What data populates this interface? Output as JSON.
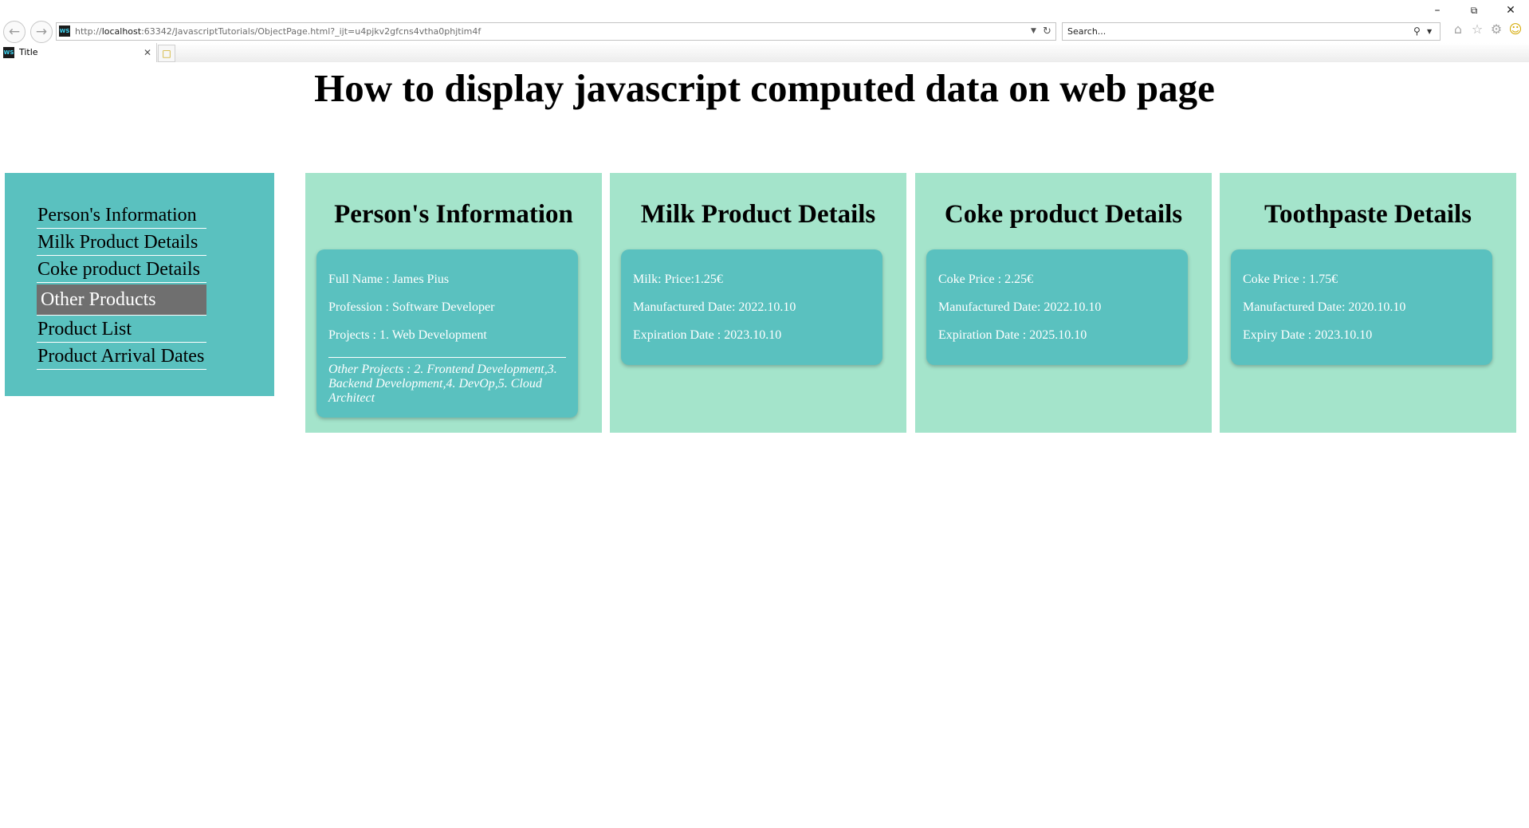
{
  "browser": {
    "url_prefix": "http://",
    "url_host": "localhost",
    "url_rest": ":63342/JavascriptTutorials/ObjectPage.html?_ijt=u4pjkv2gfcns4vtha0phjtim4f",
    "search_placeholder": "Search...",
    "tab_title": "Title",
    "favicon_text": "WS",
    "icons": {
      "back": "back-arrow-icon",
      "forward": "forward-arrow-icon",
      "refresh": "refresh-icon",
      "dropdown": "chevron-down-icon",
      "search": "search-icon",
      "home": "home-icon",
      "favorites": "star-icon",
      "settings": "gear-icon",
      "feedback": "smiley-icon",
      "minimize": "minimize-icon",
      "restore": "restore-icon",
      "close": "close-icon"
    }
  },
  "page": {
    "heading": "How to display javascript computed data on web page"
  },
  "sidebar": {
    "items": [
      {
        "label": "Person's Information",
        "active": false
      },
      {
        "label": "Milk Product Details",
        "active": false
      },
      {
        "label": "Coke product Details",
        "active": false
      },
      {
        "label": "Other Products",
        "active": true
      },
      {
        "label": "Product List",
        "active": false
      },
      {
        "label": "Product Arrival Dates",
        "active": false
      }
    ]
  },
  "cards": {
    "person": {
      "title": "Person's Information",
      "lines": [
        "Full Name : James Pius",
        "Profession : Software Developer",
        "Projects : 1. Web Development"
      ],
      "other_projects": "Other Projects : 2. Frontend Development,3. Backend Development,4. DevOp,5. Cloud Architect"
    },
    "milk": {
      "title": "Milk Product Details",
      "lines": [
        "Milk: Price:1.25€",
        "Manufactured Date: 2022.10.10",
        "Expiration Date : 2023.10.10"
      ]
    },
    "coke": {
      "title": "Coke product Details",
      "lines": [
        "Coke Price : 2.25€",
        "Manufactured Date: 2022.10.10",
        "Expiration Date : 2025.10.10"
      ]
    },
    "toothpaste": {
      "title": "Toothpaste Details",
      "lines": [
        "Coke Price : 1.75€",
        "Manufactured Date: 2020.10.10",
        "Expiry Date : 2023.10.10"
      ]
    }
  },
  "colors": {
    "sidebar_bg": "#5ac1bf",
    "card_bg": "#a4e4cb",
    "card_inner_bg": "#5ac1bf",
    "active_item_bg": "#6f6f6f"
  }
}
